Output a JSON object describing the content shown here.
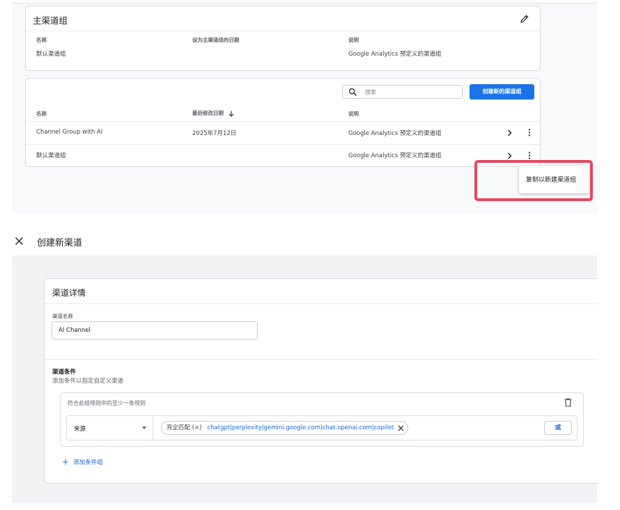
{
  "primary_group_card": {
    "title": "主渠道组",
    "headers": {
      "name": "名称",
      "set_date": "设为主渠道组的日期",
      "description": "说明"
    },
    "row": {
      "name": "默认渠道组",
      "set_date": "",
      "description": "Google Analytics 预定义的渠道组"
    }
  },
  "group_list_card": {
    "search_placeholder": "搜索",
    "create_button": "创建新的渠道组",
    "headers": {
      "name": "名称",
      "modified": "最后修改日期",
      "description": "说明"
    },
    "rows": [
      {
        "name": "Channel Group with AI",
        "modified": "2025年7月12日",
        "description": "Google Analytics 预定义的渠道组"
      },
      {
        "name": "默认渠道组",
        "modified": "",
        "description": "Google Analytics 预定义的渠道组"
      }
    ]
  },
  "context_menu": {
    "item": "复制以新建渠道组",
    "highlight_color": "#e4475f"
  },
  "create_channel": {
    "page_title": "创建新渠道",
    "details_title": "渠道详情",
    "name_label": "渠道名称",
    "name_value": "AI Channel",
    "conditions_title": "渠道条件",
    "conditions_subtitle": "添加条件以指定自定义渠道",
    "group_rule_label": "符合此组规则中的至少一条规则",
    "dimension": "来源",
    "match_type": "完全匹配 (=)",
    "match_value": "chatgpt|perplexity|gemini.google.com|chat.openai.com|copilot",
    "or_button": "或",
    "add_group": "添加条件组"
  },
  "colors": {
    "accent": "#1a73e8",
    "link": "#1967d2"
  }
}
